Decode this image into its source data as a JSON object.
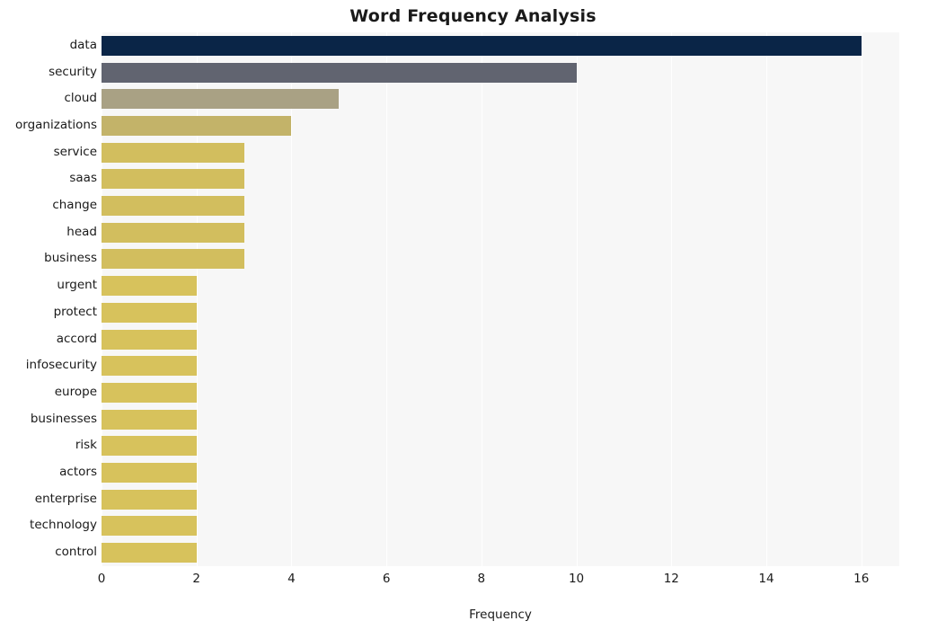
{
  "chart_data": {
    "type": "bar",
    "orientation": "horizontal",
    "title": "Word Frequency Analysis",
    "xlabel": "Frequency",
    "ylabel": "",
    "xlim": [
      0,
      16.8
    ],
    "grid": true,
    "legend": "none",
    "categories": [
      "data",
      "security",
      "cloud",
      "organizations",
      "service",
      "saas",
      "change",
      "head",
      "business",
      "urgent",
      "protect",
      "accord",
      "infosecurity",
      "europe",
      "businesses",
      "risk",
      "actors",
      "enterprise",
      "technology",
      "control"
    ],
    "values": [
      16,
      10,
      5,
      4,
      3,
      3,
      3,
      3,
      3,
      2,
      2,
      2,
      2,
      2,
      2,
      2,
      2,
      2,
      2,
      2
    ],
    "bar_colors": [
      "#0a2547",
      "#616470",
      "#a9a184",
      "#c3b369",
      "#d2be5e",
      "#d2be5e",
      "#d2be5e",
      "#d2be5e",
      "#d2be5e",
      "#d7c25c",
      "#d7c25c",
      "#d7c25c",
      "#d7c25c",
      "#d7c25c",
      "#d7c25c",
      "#d7c25c",
      "#d7c25c",
      "#d7c25c",
      "#d7c25c",
      "#d7c25c"
    ],
    "xticks": [
      0,
      2,
      4,
      6,
      8,
      10,
      12,
      14,
      16
    ],
    "xtick_labels": [
      "0",
      "2",
      "4",
      "6",
      "8",
      "10",
      "12",
      "14",
      "16"
    ],
    "plot_background": "#f7f7f7",
    "grid_color": "#ffffff",
    "figure_background": "#ffffff"
  }
}
